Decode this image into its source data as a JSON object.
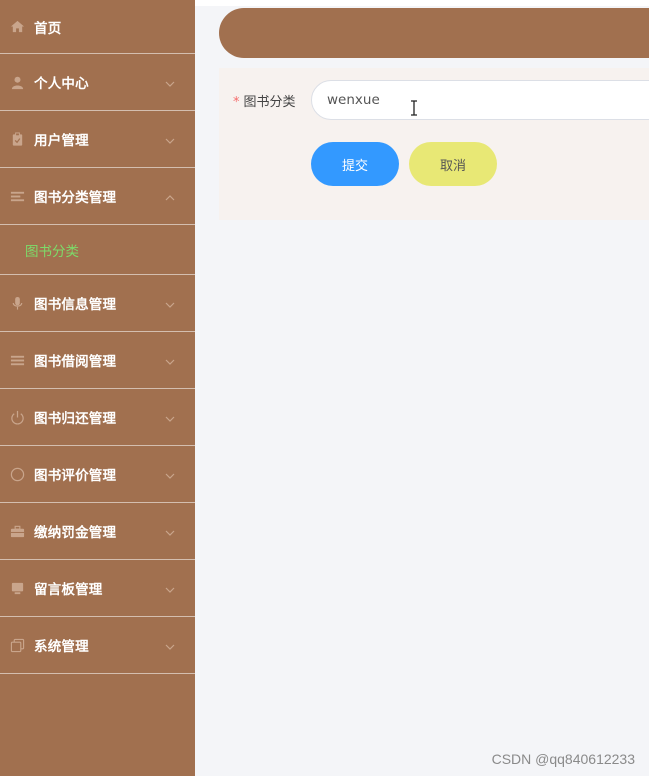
{
  "sidebar": {
    "items": [
      {
        "label": "首页",
        "icon": "home-icon"
      },
      {
        "label": "个人中心",
        "icon": "user-icon"
      },
      {
        "label": "用户管理",
        "icon": "clipboard-icon"
      },
      {
        "label": "图书分类管理",
        "icon": "list-icon",
        "expanded": true,
        "children": [
          {
            "label": "图书分类",
            "active": true
          }
        ]
      },
      {
        "label": "图书信息管理",
        "icon": "microphone-icon"
      },
      {
        "label": "图书借阅管理",
        "icon": "menu-icon"
      },
      {
        "label": "图书归还管理",
        "icon": "power-icon"
      },
      {
        "label": "图书评价管理",
        "icon": "compass-icon"
      },
      {
        "label": "缴纳罚金管理",
        "icon": "briefcase-icon"
      },
      {
        "label": "留言板管理",
        "icon": "monitor-icon"
      },
      {
        "label": "系统管理",
        "icon": "copy-icon"
      }
    ]
  },
  "form": {
    "field_label": "图书分类",
    "required_mark": "*",
    "field_value": "wenxue",
    "submit_label": "提交",
    "cancel_label": "取消"
  },
  "watermark": "CSDN @qq840612233",
  "colors": {
    "sidebar_bg": "#a1704f",
    "active_sub": "#7ddc6a",
    "submit_bg": "#3399ff",
    "cancel_bg": "#e8e875",
    "content_bg": "#f4f5f8"
  }
}
